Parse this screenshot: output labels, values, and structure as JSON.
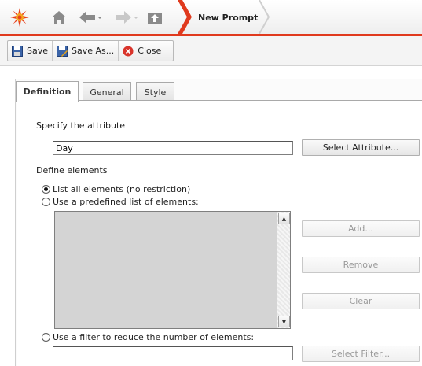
{
  "header": {
    "title": "New Prompt",
    "icons": [
      "logo-icon",
      "home-icon",
      "back-icon",
      "forward-icon",
      "up-icon"
    ],
    "accent": "#e03a1e"
  },
  "toolbar": {
    "save_label": "Save",
    "save_as_label": "Save As...",
    "close_label": "Close"
  },
  "tabs": [
    {
      "label": "Definition",
      "active": true
    },
    {
      "label": "General",
      "active": false
    },
    {
      "label": "Style",
      "active": false
    }
  ],
  "definition": {
    "attribute_label": "Specify the attribute",
    "attribute_value": "Day",
    "select_attribute_label": "Select Attribute...",
    "define_elements_label": "Define elements",
    "options": [
      {
        "label": "List all elements (no restriction)",
        "selected": true
      },
      {
        "label": "Use a predefined list of elements:",
        "selected": false
      },
      {
        "label": "Use a filter to reduce the number of elements:",
        "selected": false
      }
    ],
    "add_label": "Add...",
    "remove_label": "Remove",
    "clear_label": "Clear",
    "filter_value": "",
    "select_filter_label": "Select Filter..."
  }
}
